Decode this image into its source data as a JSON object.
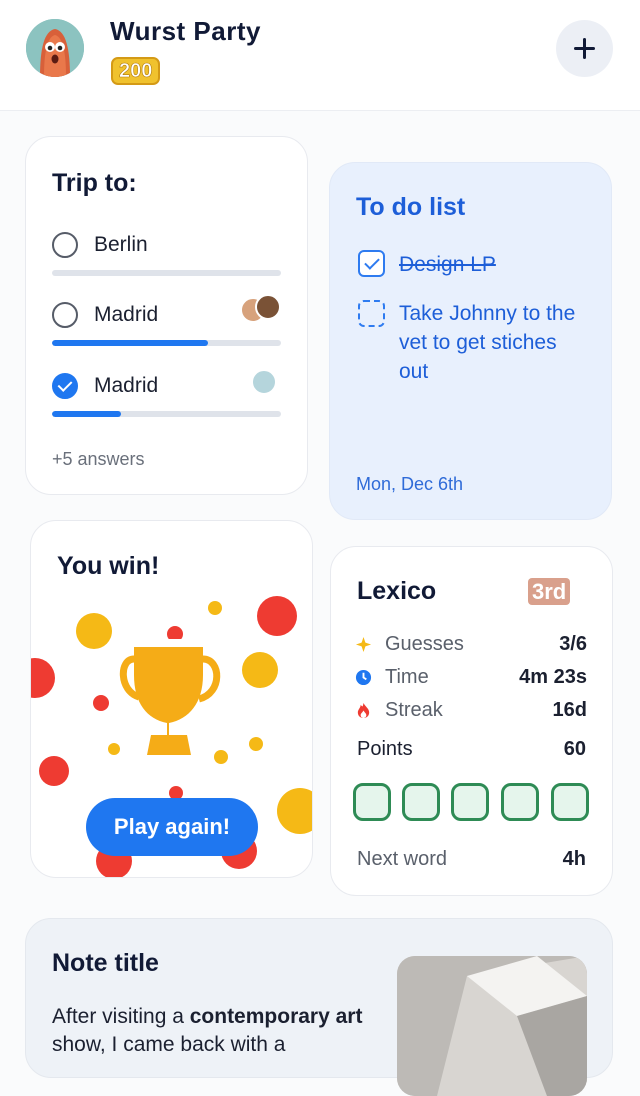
{
  "header": {
    "title": "Wurst Party",
    "score": "200"
  },
  "poll": {
    "title": "Trip to:",
    "options": [
      {
        "label": "Berlin",
        "selected": false,
        "progress": 0
      },
      {
        "label": "Madrid",
        "selected": false,
        "progress": 0.68
      },
      {
        "label": "Madrid",
        "selected": true,
        "progress": 0.3
      }
    ],
    "more_answers": "+5 answers"
  },
  "todo": {
    "title": "To do list",
    "items": [
      {
        "text": "Design LP",
        "done": true
      },
      {
        "text": "Take Johnny to the vet to get stiches out",
        "done": false
      }
    ],
    "date": "Mon, Dec 6th"
  },
  "win_card": {
    "title": "You win!",
    "button_label": "Play again!"
  },
  "lexico": {
    "title": "Lexico",
    "rank": "3rd",
    "stats": [
      {
        "label": "Guesses",
        "value": "3/6",
        "icon": "sparkle-icon"
      },
      {
        "label": "Time",
        "value": "4m 23s",
        "icon": "clock-icon"
      },
      {
        "label": "Streak",
        "value": "16d",
        "icon": "fire-icon"
      }
    ],
    "points_label": "Points",
    "points_value": "60",
    "next_word_label": "Next word",
    "next_word_value": "4h"
  },
  "note": {
    "title": "Note title",
    "text_parts": [
      "After visiting a ",
      "contemporary",
      " ",
      "art",
      " show, I came back with a"
    ]
  },
  "colors": {
    "accent": "#1f77f0",
    "todo_bg": "#e8f0fd",
    "todo_text": "#1d5ed8",
    "tile_green": "#2e8b55"
  }
}
